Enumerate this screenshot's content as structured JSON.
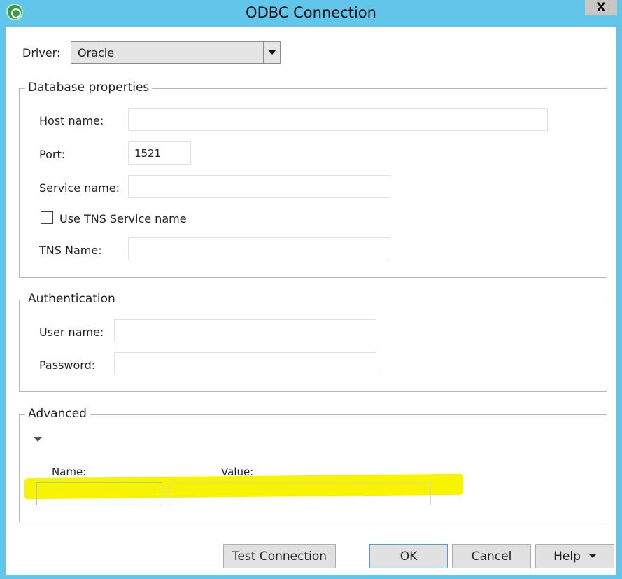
{
  "window": {
    "title": "ODBC Connection",
    "close_label": "X"
  },
  "driver": {
    "label": "Driver:",
    "selected": "Oracle"
  },
  "database_properties": {
    "legend": "Database properties",
    "host_label": "Host name:",
    "host_value": "",
    "port_label": "Port:",
    "port_value": "1521",
    "service_label": "Service name:",
    "service_value": "",
    "use_tns_label": "Use TNS Service name",
    "use_tns_checked": false,
    "tns_label": "TNS Name:",
    "tns_value": ""
  },
  "authentication": {
    "legend": "Authentication",
    "user_label": "User name:",
    "user_value": "",
    "password_label": "Password:",
    "password_value": ""
  },
  "advanced": {
    "legend": "Advanced",
    "name_label": "Name:",
    "name_value": "",
    "value_label": "Value:",
    "value_value": "",
    "highlight_color": "#f8f400"
  },
  "buttons": {
    "test_connection": "Test Connection",
    "ok": "OK",
    "cancel": "Cancel",
    "help": "Help"
  },
  "colors": {
    "titlebar": "#62c6ea",
    "default_button_border": "#4f9ee5"
  }
}
